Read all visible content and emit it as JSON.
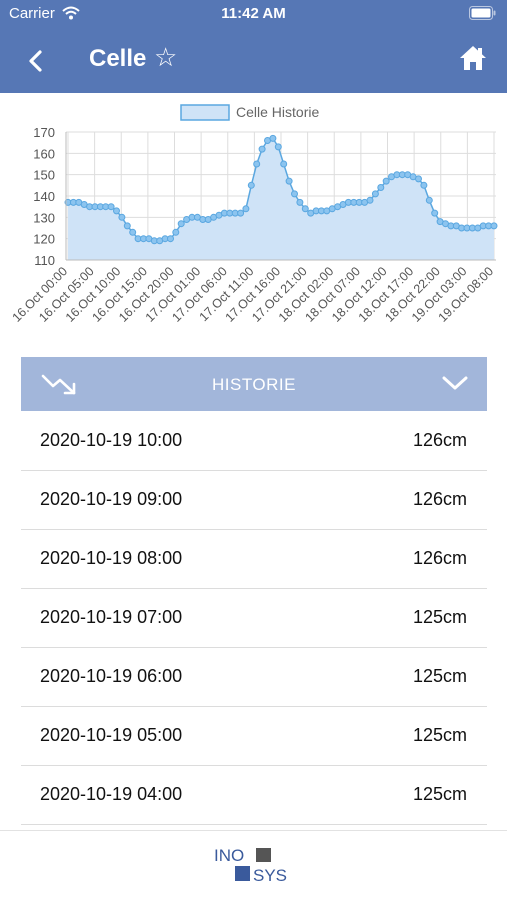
{
  "status_bar": {
    "carrier": "Carrier",
    "time": "11:42 AM"
  },
  "nav": {
    "title": "Celle",
    "star_glyph": "☆",
    "back_icon": "chevron-left-icon",
    "home_icon": "home-icon"
  },
  "chart_data": {
    "type": "area",
    "legend": "Celle Historie",
    "ylim": [
      110,
      170
    ],
    "y_ticks": [
      110,
      120,
      130,
      140,
      150,
      160,
      170
    ],
    "x_labels": [
      "16.Oct 00:00",
      "16.Oct 05:00",
      "16.Oct 10:00",
      "16.Oct 15:00",
      "16.Oct 20:00",
      "17.Oct 01:00",
      "17.Oct 06:00",
      "17.Oct 11:00",
      "17.Oct 16:00",
      "17.Oct 21:00",
      "18.Oct 02:00",
      "18.Oct 07:00",
      "18.Oct 12:00",
      "18.Oct 17:00",
      "18.Oct 22:00",
      "19.Oct 03:00",
      "19.Oct 08:00"
    ],
    "series": [
      {
        "name": "Celle Historie",
        "values": [
          137,
          137,
          137,
          136,
          135,
          135,
          135,
          135,
          135,
          133,
          130,
          126,
          123,
          120,
          120,
          120,
          119,
          119,
          120,
          120,
          123,
          127,
          129,
          130,
          130,
          129,
          129,
          130,
          131,
          132,
          132,
          132,
          132,
          134,
          145,
          155,
          162,
          166,
          167,
          163,
          155,
          147,
          141,
          137,
          134,
          132,
          133,
          133,
          133,
          134,
          135,
          136,
          137,
          137,
          137,
          137,
          138,
          141,
          144,
          147,
          149,
          150,
          150,
          150,
          149,
          148,
          145,
          138,
          132,
          128,
          127,
          126,
          126,
          125,
          125,
          125,
          125,
          126,
          126,
          126
        ]
      }
    ],
    "color": "#5aa7e0",
    "fill": "#cfe3f7",
    "grid": true
  },
  "historie": {
    "label": "HISTORIE",
    "trend_icon": "trend-down-icon",
    "toggle_icon": "chevron-down-icon",
    "rows": [
      {
        "datetime": "2020-10-19 10:00",
        "value": "126cm"
      },
      {
        "datetime": "2020-10-19 09:00",
        "value": "126cm"
      },
      {
        "datetime": "2020-10-19 08:00",
        "value": "126cm"
      },
      {
        "datetime": "2020-10-19 07:00",
        "value": "125cm"
      },
      {
        "datetime": "2020-10-19 06:00",
        "value": "125cm"
      },
      {
        "datetime": "2020-10-19 05:00",
        "value": "125cm"
      },
      {
        "datetime": "2020-10-19 04:00",
        "value": "125cm"
      }
    ]
  },
  "footer": {
    "logo_top": "INO",
    "logo_bottom": "SYS",
    "logo_color": "#3a5a9c"
  }
}
